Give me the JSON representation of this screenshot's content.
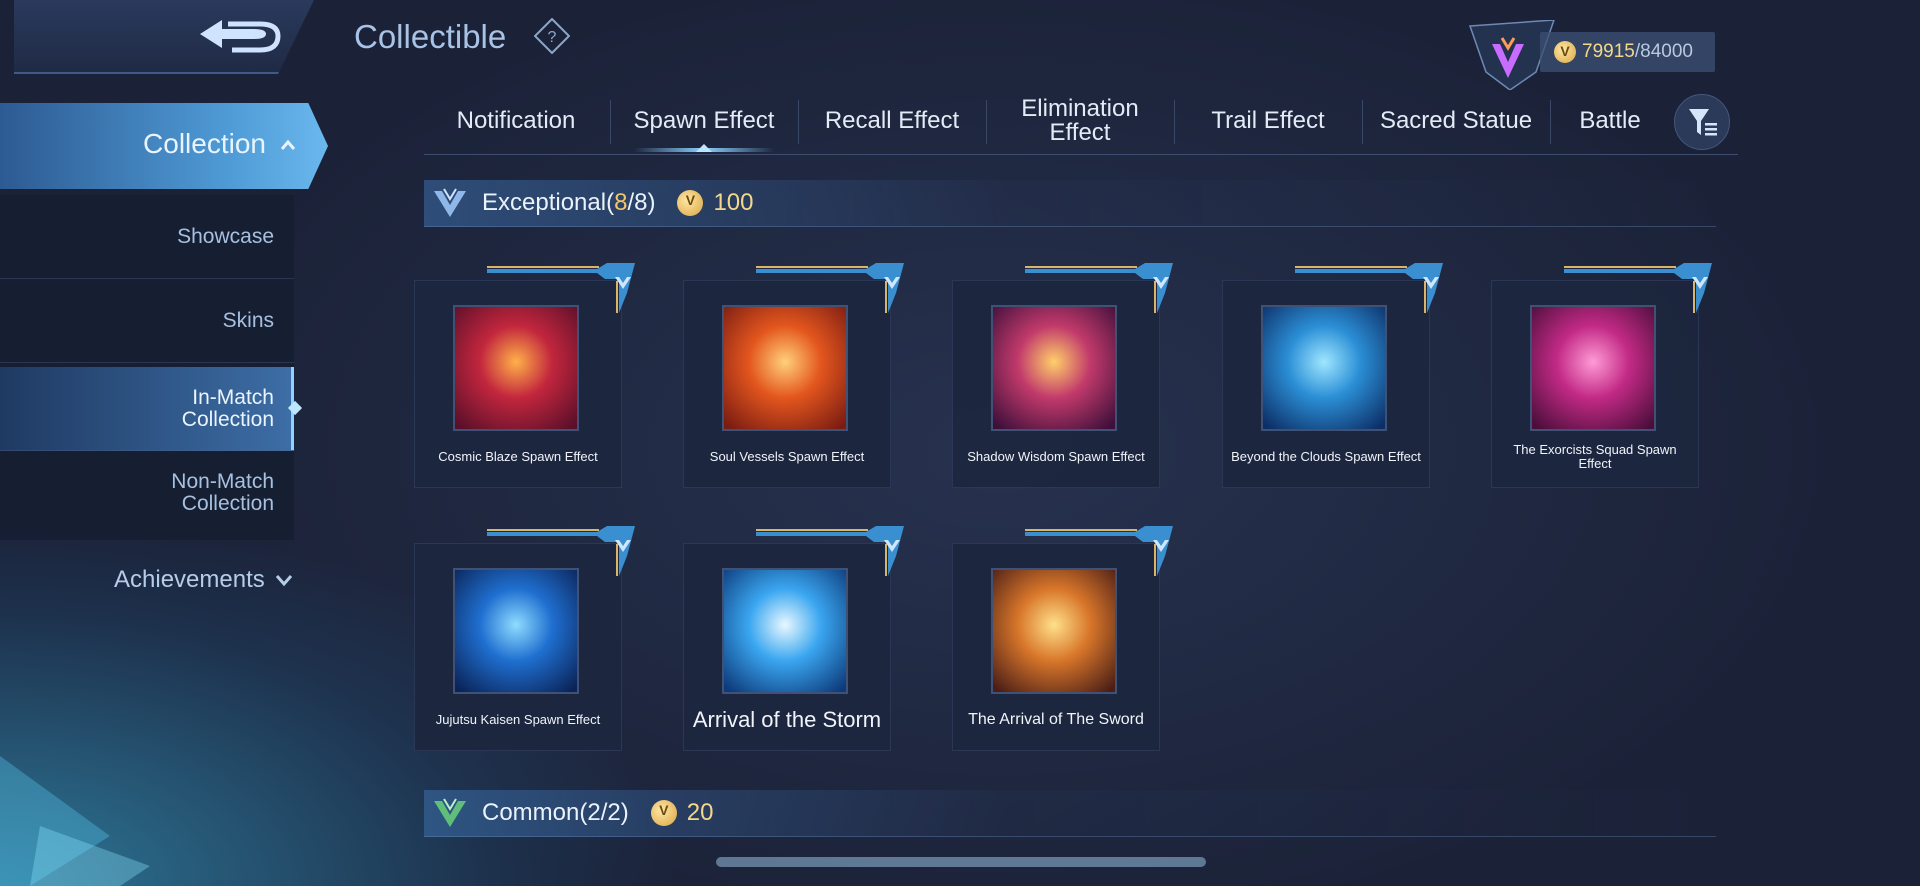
{
  "header": {
    "title": "Collectible",
    "currency_value": "79915",
    "currency_max": "/84000"
  },
  "sidebar": {
    "collection_label": "Collection",
    "items": [
      {
        "label": "Showcase"
      },
      {
        "label": "Skins"
      },
      {
        "label": "In-Match Collection",
        "active": true
      },
      {
        "label": "Non-Match Collection"
      }
    ],
    "achievements_label": "Achievements"
  },
  "tabs": [
    {
      "label": "Notification"
    },
    {
      "label": "Spawn Effect",
      "selected": true
    },
    {
      "label": "Recall Effect"
    },
    {
      "label": "Elimination Effect"
    },
    {
      "label": "Trail Effect"
    },
    {
      "label": "Sacred Statue"
    },
    {
      "label": "Battle"
    }
  ],
  "sections": [
    {
      "name": "Exceptional",
      "count_open": "(",
      "count_owned": "8",
      "count_total": "/8)",
      "points": "100",
      "items": [
        {
          "name": "Cosmic Blaze Spawn Effect",
          "colors": [
            "#ffb04a",
            "#c2263d",
            "#5a0f2a"
          ]
        },
        {
          "name": "Soul Vessels Spawn Effect",
          "colors": [
            "#ffd07a",
            "#e3561e",
            "#7a1c12"
          ]
        },
        {
          "name": "Shadow Wisdom Spawn Effect",
          "colors": [
            "#ffcf6a",
            "#c13a6b",
            "#3d0f3a"
          ]
        },
        {
          "name": "Beyond the Clouds Spawn Effect",
          "colors": [
            "#9fe6ff",
            "#2b8fd6",
            "#0d2e66"
          ]
        },
        {
          "name": "The Exorcists Squad Spawn Effect",
          "colors": [
            "#ff9ad6",
            "#c22a85",
            "#4a0e3a"
          ]
        },
        {
          "name": "Jujutsu Kaisen Spawn Effect",
          "colors": [
            "#8fdcff",
            "#1f6fd0",
            "#0b2357"
          ]
        },
        {
          "name": "Arrival of the Storm",
          "colors": [
            "#e8f8ff",
            "#3aa6f0",
            "#0d3a7a"
          ]
        },
        {
          "name": "The Arrival of The Sword",
          "colors": [
            "#ffe08a",
            "#d8762a",
            "#4a1e16"
          ]
        }
      ]
    },
    {
      "name": "Common",
      "count_open": "(",
      "count_owned": "2",
      "count_total": "/2)",
      "points": "20"
    }
  ]
}
